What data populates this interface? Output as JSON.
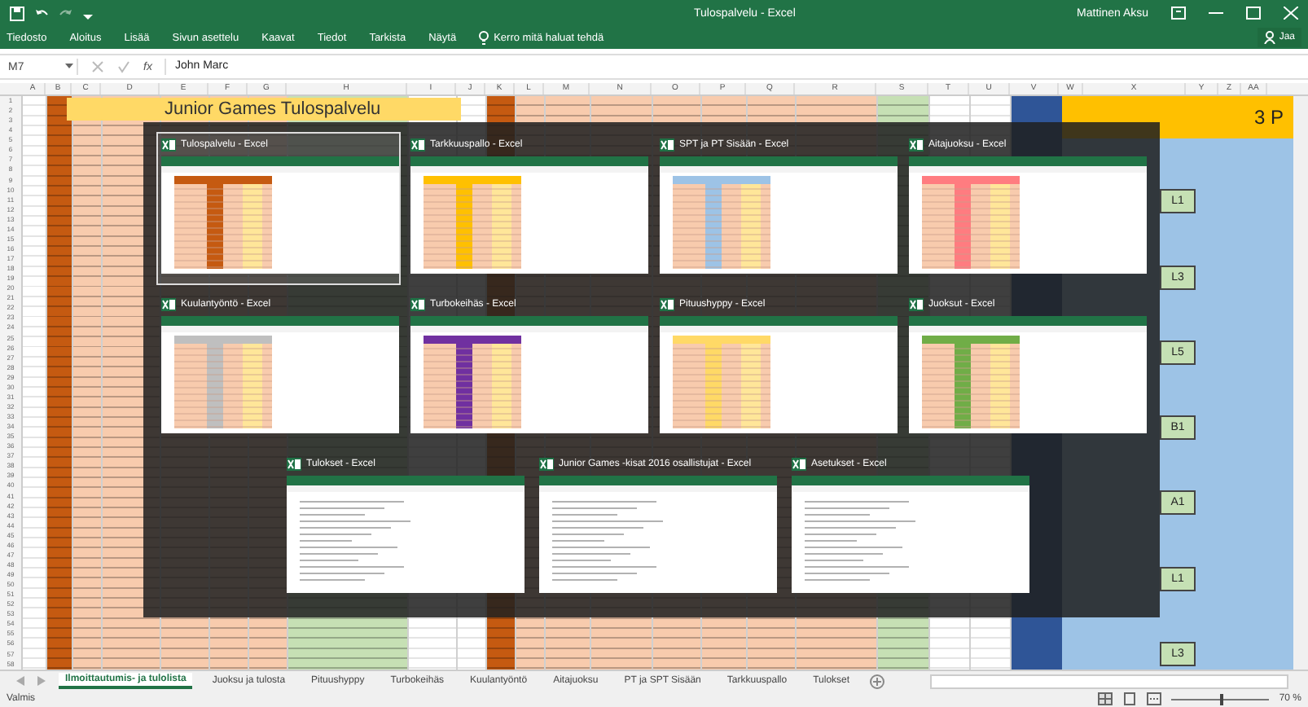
{
  "window": {
    "title": "Tulospalvelu - Excel",
    "user": "Mattinen Aksu"
  },
  "ribbon_tabs": [
    "Tiedosto",
    "Aloitus",
    "Lisää",
    "Sivun asettelu",
    "Kaavat",
    "Tiedot",
    "Tarkista",
    "Näytä"
  ],
  "tell_me": "Kerro mitä haluat tehdä",
  "share": "Jaa",
  "formula_bar": {
    "name_box": "M7",
    "function_label": "fx",
    "formula": "John Marc"
  },
  "columns": [
    "A",
    "B",
    "C",
    "D",
    "E",
    "F",
    "G",
    "H",
    "I",
    "J",
    "K",
    "L",
    "M",
    "N",
    "O",
    "P",
    "Q",
    "R",
    "S",
    "T",
    "U",
    "V",
    "W",
    "X",
    "Y",
    "Z",
    "AA"
  ],
  "row_numbers": [
    "1",
    "2",
    "3",
    "4",
    "5",
    "6",
    "7",
    "8",
    "9",
    "10",
    "11",
    "12",
    "13",
    "14",
    "15",
    "16",
    "17",
    "18",
    "19",
    "20",
    "21",
    "22",
    "23",
    "24",
    "25",
    "26",
    "27",
    "28",
    "29",
    "30",
    "31",
    "32",
    "33",
    "34",
    "35",
    "36",
    "37",
    "38",
    "39",
    "40",
    "41",
    "42",
    "43",
    "44",
    "45",
    "46",
    "47",
    "48",
    "49",
    "50",
    "51",
    "52",
    "53",
    "54",
    "55",
    "56",
    "57",
    "58"
  ],
  "sheet_title": "Junior Games Tulospalvelu",
  "side_panel": [
    {
      "kind": "header",
      "text": "3 P"
    },
    {
      "kind": "label",
      "text": "L1"
    },
    {
      "kind": "label",
      "text": "L3"
    },
    {
      "kind": "label",
      "text": "L5"
    },
    {
      "kind": "label",
      "text": "B1"
    },
    {
      "kind": "label",
      "text": "A1"
    },
    {
      "kind": "label",
      "text": "L1"
    },
    {
      "kind": "label",
      "text": "L3"
    }
  ],
  "task_windows": [
    {
      "title": "Tulospalvelu - Excel",
      "selected": true,
      "kind": "colored",
      "color": "#c55a11"
    },
    {
      "title": "Tarkkuuspallo - Excel",
      "selected": false,
      "kind": "colored",
      "color": "#ffc000"
    },
    {
      "title": "SPT ja PT Sisään - Excel",
      "selected": false,
      "kind": "colored",
      "color": "#9dc3e6"
    },
    {
      "title": "Aitajuoksu - Excel",
      "selected": false,
      "kind": "colored",
      "color": "#ff7c80"
    },
    {
      "title": "Kuulantyöntö - Excel",
      "selected": false,
      "kind": "colored",
      "color": "#bfbfbf"
    },
    {
      "title": "Turbokeihäs - Excel",
      "selected": false,
      "kind": "colored",
      "color": "#7030a0"
    },
    {
      "title": "Pituushyppy - Excel",
      "selected": false,
      "kind": "colored",
      "color": "#ffd966"
    },
    {
      "title": "Juoksut - Excel",
      "selected": false,
      "kind": "colored",
      "color": "#70ad47"
    },
    {
      "title": "Tulokset - Excel",
      "selected": false,
      "kind": "plain"
    },
    {
      "title": "Junior Games -kisat 2016 osallistujat - Excel",
      "selected": false,
      "kind": "plain"
    },
    {
      "title": "Asetukset - Excel",
      "selected": false,
      "kind": "plain"
    }
  ],
  "sheet_tabs": [
    {
      "label": "Ilmoittautumis- ja tulolista",
      "selected": true
    },
    {
      "label": "Juoksu ja tulosta",
      "selected": false
    },
    {
      "label": "Pituushyppy",
      "selected": false
    },
    {
      "label": "Turbokeihäs",
      "selected": false
    },
    {
      "label": "Kuulantyöntö",
      "selected": false
    },
    {
      "label": "Aitajuoksu",
      "selected": false
    },
    {
      "label": "PT ja SPT Sisään",
      "selected": false
    },
    {
      "label": "Tarkkuuspallo",
      "selected": false
    },
    {
      "label": "Tulokset",
      "selected": false
    }
  ],
  "status_bar": {
    "status": "Valmis",
    "zoom": "70 %",
    "zoom_slider": {
      "level": 0.5
    }
  }
}
